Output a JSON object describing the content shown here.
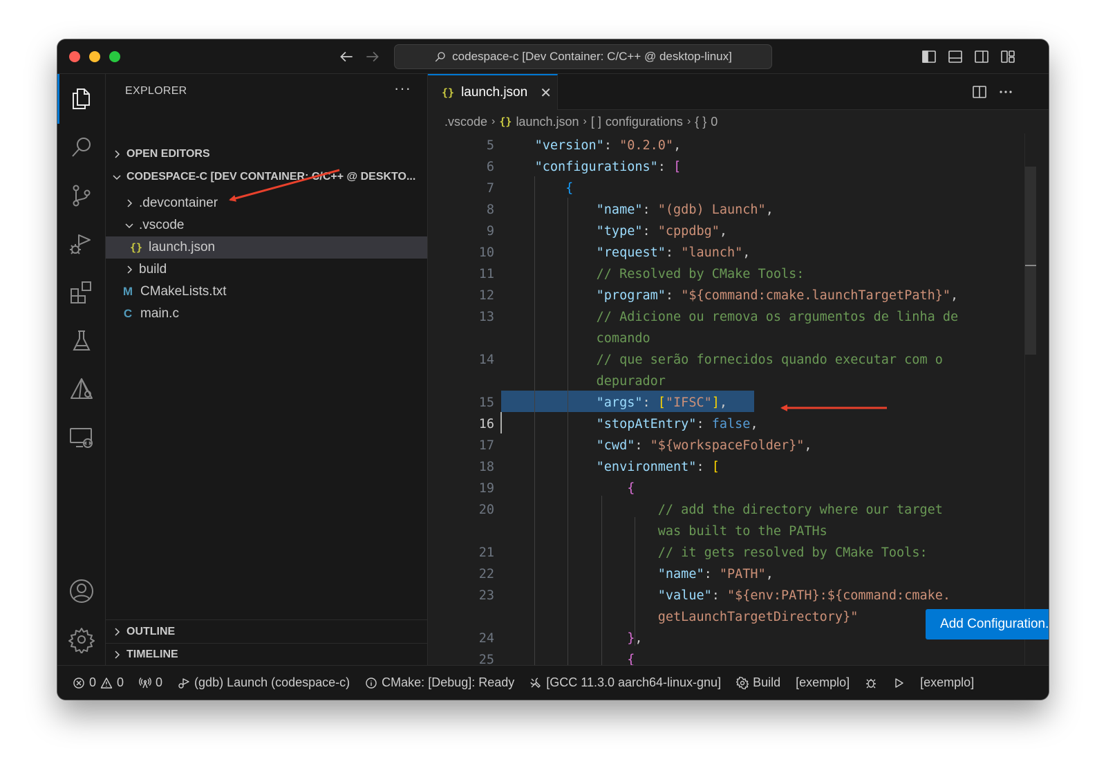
{
  "window": {
    "title": "codespace-c [Dev Container: C/C++ @ desktop-linux]"
  },
  "sidebar": {
    "title": "EXPLORER",
    "more": "···",
    "open_editors": "OPEN EDITORS",
    "workspace": "CODESPACE-C [DEV CONTAINER: C/C++ @ DESKTO...",
    "tree": [
      {
        "label": ".devcontainer",
        "kind": "folder",
        "expanded": false
      },
      {
        "label": ".vscode",
        "kind": "folder",
        "expanded": true
      },
      {
        "label": "launch.json",
        "kind": "file",
        "badge": "{}",
        "selected": true
      },
      {
        "label": "build",
        "kind": "folder",
        "expanded": false
      },
      {
        "label": "CMakeLists.txt",
        "kind": "file",
        "badge": "M",
        "badge_color": "#519aba"
      },
      {
        "label": "main.c",
        "kind": "file",
        "badge": "C",
        "badge_color": "#519aba"
      }
    ],
    "outline": "OUTLINE",
    "timeline": "TIMELINE"
  },
  "editor": {
    "tab": {
      "label": "launch.json",
      "icon": "{}",
      "close": "✕"
    },
    "breadcrumb": [
      ".vscode",
      "launch.json",
      "configurations",
      "0"
    ],
    "breadcrumb_icons": [
      "{}",
      "[ ]",
      "{ }"
    ],
    "lines": [
      {
        "n": "5",
        "text": "    \"version\": \"0.2.0\","
      },
      {
        "n": "6",
        "text": "    \"configurations\": ["
      },
      {
        "n": "7",
        "text": "        {"
      },
      {
        "n": "8",
        "text": "            \"name\": \"(gdb) Launch\","
      },
      {
        "n": "9",
        "text": "            \"type\": \"cppdbg\","
      },
      {
        "n": "10",
        "text": "            \"request\": \"launch\","
      },
      {
        "n": "11",
        "text": "            // Resolved by CMake Tools:"
      },
      {
        "n": "12",
        "text": "            \"program\": \"${command:cmake.launchTargetPath}\","
      },
      {
        "n": "13",
        "text": "            // Adicione ou remova os argumentos de linha de"
      },
      {
        "n": "",
        "text": "            comando"
      },
      {
        "n": "14",
        "text": "            // que serão fornecidos quando executar com o"
      },
      {
        "n": "",
        "text": "            depurador"
      },
      {
        "n": "15",
        "text": "            \"args\": [\"IFSC\"],"
      },
      {
        "n": "16",
        "text": "            \"stopAtEntry\": false,"
      },
      {
        "n": "17",
        "text": "            \"cwd\": \"${workspaceFolder}\","
      },
      {
        "n": "18",
        "text": "            \"environment\": ["
      },
      {
        "n": "19",
        "text": "                {"
      },
      {
        "n": "20",
        "text": "                    // add the directory where our target"
      },
      {
        "n": "",
        "text": "                    was built to the PATHs"
      },
      {
        "n": "21",
        "text": "                    // it gets resolved by CMake Tools:"
      },
      {
        "n": "22",
        "text": "                    \"name\": \"PATH\","
      },
      {
        "n": "23",
        "text": "                    \"value\": \"${env:PATH}:${command:cmake."
      },
      {
        "n": "",
        "text": "                    getLaunchTargetDirectory}\""
      },
      {
        "n": "24",
        "text": "                },"
      },
      {
        "n": "25",
        "text": "                {"
      }
    ],
    "current_line": "16",
    "add_configuration": "Add Configuration..."
  },
  "status": {
    "errors": "0",
    "warnings": "0",
    "ports": "0",
    "debug": "(gdb) Launch (codespace-c)",
    "cmake": "CMake: [Debug]: Ready",
    "kit": "[GCC 11.3.0 aarch64-linux-gnu]",
    "build": "Build",
    "target": "[exemplo]",
    "launch_target": "[exemplo]"
  },
  "colors": {
    "accent": "#0078d4",
    "annotation_arrow": "#e8412c"
  }
}
